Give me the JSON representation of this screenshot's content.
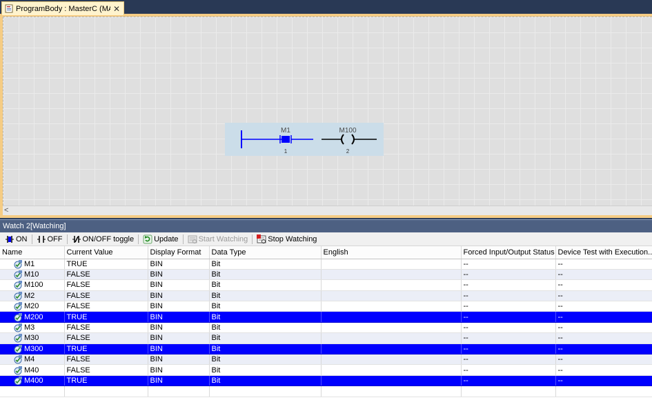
{
  "tab": {
    "title": "ProgramBody : MasterC (MAIN...",
    "close": "✕",
    "icon": "program-document-icon"
  },
  "ladder": {
    "contact_device": "M1",
    "contact_step": "1",
    "coil_device": "M100",
    "coil_step": "2"
  },
  "watch": {
    "title": "Watch 2[Watching]",
    "toolbar": {
      "on": "ON",
      "off": "OFF",
      "toggle": "ON/OFF toggle",
      "update": "Update",
      "start": "Start Watching",
      "stop": "Stop Watching"
    },
    "columns": {
      "name": "Name",
      "value": "Current Value",
      "format": "Display Format",
      "type": "Data Type",
      "english": "English",
      "forced": "Forced Input/Output Status",
      "test": "Device Test with Execution..."
    },
    "rows": [
      {
        "name": "M1",
        "value": "TRUE",
        "format": "BIN",
        "type": "Bit",
        "english": "",
        "forced": "--",
        "test": "--"
      },
      {
        "name": "M10",
        "value": "FALSE",
        "format": "BIN",
        "type": "Bit",
        "english": "",
        "forced": "--",
        "test": "--"
      },
      {
        "name": "M100",
        "value": "FALSE",
        "format": "BIN",
        "type": "Bit",
        "english": "",
        "forced": "--",
        "test": "--"
      },
      {
        "name": "M2",
        "value": "FALSE",
        "format": "BIN",
        "type": "Bit",
        "english": "",
        "forced": "--",
        "test": "--"
      },
      {
        "name": "M20",
        "value": "FALSE",
        "format": "BIN",
        "type": "Bit",
        "english": "",
        "forced": "--",
        "test": "--"
      },
      {
        "name": "M200",
        "value": "TRUE",
        "format": "BIN",
        "type": "Bit",
        "english": "",
        "forced": "--",
        "test": "--"
      },
      {
        "name": "M3",
        "value": "FALSE",
        "format": "BIN",
        "type": "Bit",
        "english": "",
        "forced": "--",
        "test": "--"
      },
      {
        "name": "M30",
        "value": "FALSE",
        "format": "BIN",
        "type": "Bit",
        "english": "",
        "forced": "--",
        "test": "--"
      },
      {
        "name": "M300",
        "value": "TRUE",
        "format": "BIN",
        "type": "Bit",
        "english": "",
        "forced": "--",
        "test": "--"
      },
      {
        "name": "M4",
        "value": "FALSE",
        "format": "BIN",
        "type": "Bit",
        "english": "",
        "forced": "--",
        "test": "--"
      },
      {
        "name": "M40",
        "value": "FALSE",
        "format": "BIN",
        "type": "Bit",
        "english": "",
        "forced": "--",
        "test": "--"
      },
      {
        "name": "M400",
        "value": "TRUE",
        "format": "BIN",
        "type": "Bit",
        "english": "",
        "forced": "--",
        "test": "--"
      }
    ]
  },
  "colors": {
    "selected_row": "#0000ff",
    "alt_row": "#ebeef7",
    "ladder_active": "#0000ff",
    "tab_accent": "#f5cc84"
  }
}
